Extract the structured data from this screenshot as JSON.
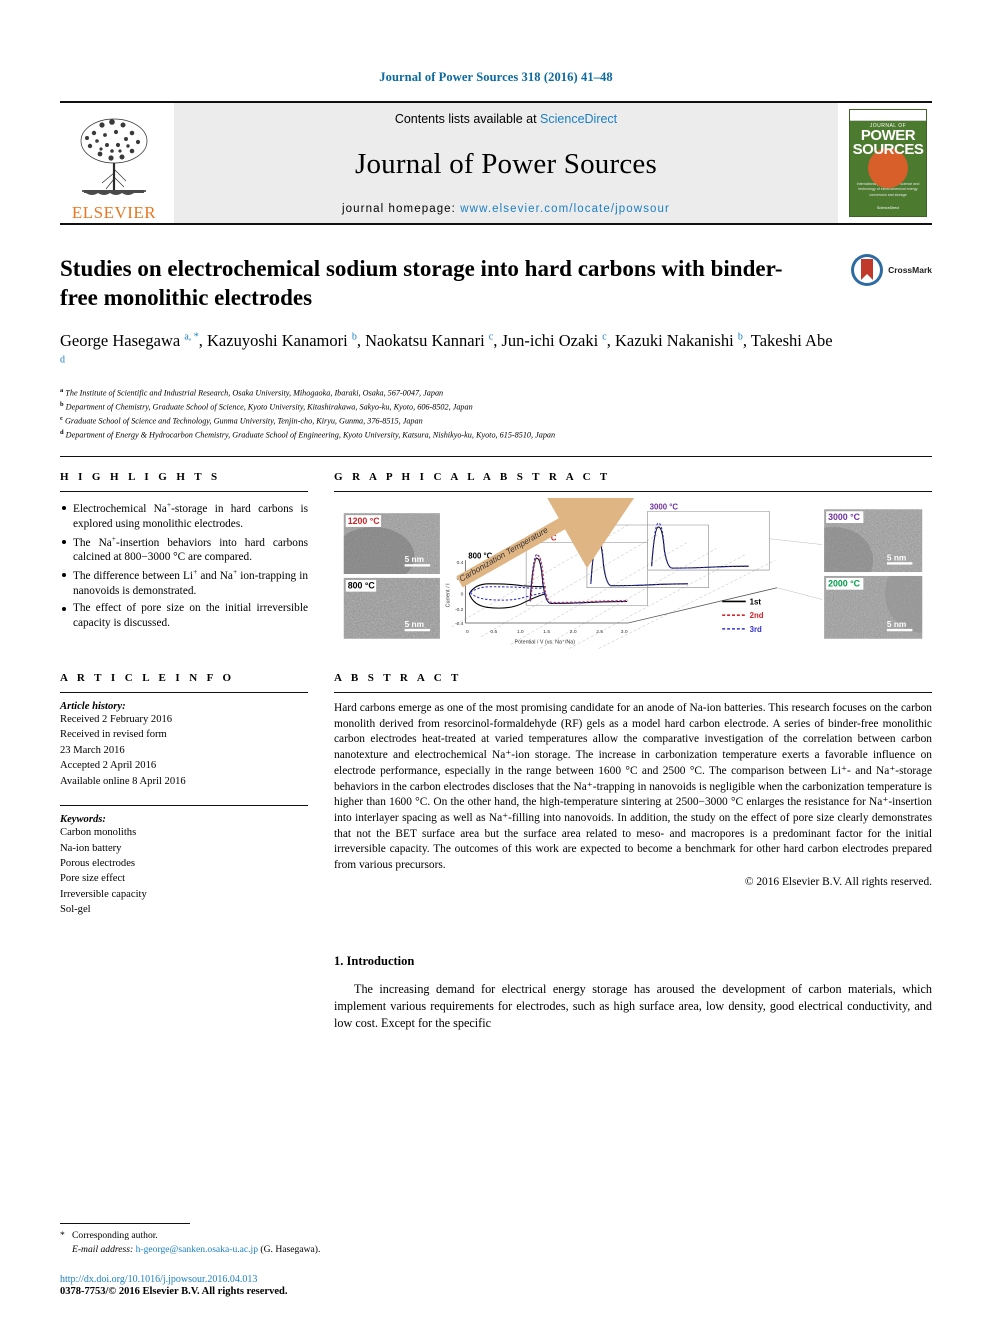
{
  "runhead": "Journal of Power Sources 318 (2016) 41–48",
  "masthead": {
    "contents_prefix": "Contents lists available at ",
    "sciencedirect": "ScienceDirect",
    "journal_title": "Journal of Power Sources",
    "homepage_prefix": "journal homepage: ",
    "homepage_url": "www.elsevier.com/locate/jpowsour",
    "publisher": "ELSEVIER",
    "cover": {
      "jof": "JOURNAL OF",
      "power": "POWER",
      "sources": "SOURCES",
      "subtitle": "International journal on the science and technology of electrochemical energy conversion and storage",
      "footer": "ScienceDirect"
    }
  },
  "article": {
    "title": "Studies on electrochemical sodium storage into hard carbons with binder-free monolithic electrodes",
    "crossmark_label": "CrossMark",
    "authors": [
      {
        "name": "George Hasegawa",
        "marks": "a, *"
      },
      {
        "name": "Kazuyoshi Kanamori",
        "marks": "b"
      },
      {
        "name": "Naokatsu Kannari",
        "marks": "c"
      },
      {
        "name": "Jun-ichi Ozaki",
        "marks": "c"
      },
      {
        "name": "Kazuki Nakanishi",
        "marks": "b"
      },
      {
        "name": "Takeshi Abe",
        "marks": "d"
      }
    ],
    "affiliations": [
      {
        "mark": "a",
        "text": "The Institute of Scientific and Industrial Research, Osaka University, Mihogaoka, Ibaraki, Osaka, 567-0047, Japan"
      },
      {
        "mark": "b",
        "text": "Department of Chemistry, Graduate School of Science, Kyoto University, Kitashirakawa, Sakyo-ku, Kyoto, 606-8502, Japan"
      },
      {
        "mark": "c",
        "text": "Graduate School of Science and Technology, Gunma University, Tenjin-cho, Kiryu, Gunma, 376-8515, Japan"
      },
      {
        "mark": "d",
        "text": "Department of Energy & Hydrocarbon Chemistry, Graduate School of Engineering, Kyoto University, Katsura, Nishikyo-ku, Kyoto, 615-8510, Japan"
      }
    ]
  },
  "highlights": {
    "heading": "H I G H L I G H T S",
    "items": [
      "Electrochemical Na⁺-storage in hard carbons is explored using monolithic electrodes.",
      "The Na⁺-insertion behaviors into hard carbons calcined at 800−3000 °C are compared.",
      "The difference between Li⁺ and Na⁺ ion-trapping in nanovoids is demonstrated.",
      "The effect of pore size on the initial irreversible capacity is discussed."
    ]
  },
  "graphical_abstract": {
    "heading": "G R A P H I C A L   A B S T R A C T",
    "arrow_label": "Carbonization Temperature",
    "tem_panels": [
      {
        "label": "1200 °C",
        "color": "#d2232a",
        "scale": "5 nm"
      },
      {
        "label": "800 °C",
        "color": "#000000",
        "scale": "5 nm"
      },
      {
        "label": "3000 °C",
        "color": "#7030a0",
        "scale": "5 nm"
      },
      {
        "label": "2000 °C",
        "color": "#00a04a",
        "scale": "5 nm"
      }
    ],
    "cv_panels": [
      {
        "label": "800 °C",
        "color": "#000000"
      },
      {
        "label": "1200 °C",
        "color": "#d2232a"
      },
      {
        "label": "2000 °C",
        "color": "#00a04a"
      },
      {
        "label": "3000 °C",
        "color": "#7030a0"
      }
    ],
    "legend": [
      {
        "label": "1st",
        "color": "#000000",
        "style": "solid"
      },
      {
        "label": "2nd",
        "color": "#d2232a",
        "style": "dotted"
      },
      {
        "label": "3rd",
        "color": "#3333cc",
        "style": "dotted"
      }
    ],
    "xlabel": "Potential / V (vs. Na⁺/Na)",
    "ylabel": "Current / I",
    "xticks": [
      "0",
      "0.5",
      "1.0",
      "1.5",
      "2.0",
      "2.5",
      "3.0"
    ],
    "yticks": [
      "0.4",
      "0.2",
      "0",
      "-0.2",
      "-0.4"
    ]
  },
  "article_info": {
    "heading": "A R T I C L E   I N F O",
    "history_label": "Article history:",
    "history": [
      "Received 2 February 2016",
      "Received in revised form",
      "23 March 2016",
      "Accepted 2 April 2016",
      "Available online 8 April 2016"
    ],
    "keywords_label": "Keywords:",
    "keywords": [
      "Carbon monoliths",
      "Na-ion battery",
      "Porous electrodes",
      "Pore size effect",
      "Irreversible capacity",
      "Sol-gel"
    ]
  },
  "abstract": {
    "heading": "A B S T R A C T",
    "body": "Hard carbons emerge as one of the most promising candidate for an anode of Na-ion batteries. This research focuses on the carbon monolith derived from resorcinol-formaldehyde (RF) gels as a model hard carbon electrode. A series of binder-free monolithic carbon electrodes heat-treated at varied temperatures allow the comparative investigation of the correlation between carbon nanotexture and electrochemical Na⁺-ion storage. The increase in carbonization temperature exerts a favorable influence on electrode performance, especially in the range between 1600 °C and 2500 °C. The comparison between Li⁺- and Na⁺-storage behaviors in the carbon electrodes discloses that the Na⁺-trapping in nanovoids is negligible when the carbonization temperature is higher than 1600 °C. On the other hand, the high-temperature sintering at 2500−3000 °C enlarges the resistance for Na⁺-insertion into interlayer spacing as well as Na⁺-filling into nanovoids. In addition, the study on the effect of pore size clearly demonstrates that not the BET surface area but the surface area related to meso- and macropores is a predominant factor for the initial irreversible capacity. The outcomes of this work are expected to become a benchmark for other hard carbon electrodes prepared from various precursors.",
    "copyright": "© 2016 Elsevier B.V. All rights reserved."
  },
  "introduction": {
    "heading": "1.  Introduction",
    "paragraph": "The increasing demand for electrical energy storage has aroused the development of carbon materials, which implement various requirements for electrodes, such as high surface area, low density, good electrical conductivity, and low cost. Except for the specific"
  },
  "footer": {
    "corresponding_star": "*",
    "corresponding_label": "Corresponding author.",
    "email_label": "E-mail address:",
    "email": "h-george@sanken.osaka-u.ac.jp",
    "email_suffix": "(G. Hasegawa).",
    "doi": "http://dx.doi.org/10.1016/j.jpowsour.2016.04.013",
    "issn": "0378-7753/© 2016 Elsevier B.V. All rights reserved."
  }
}
